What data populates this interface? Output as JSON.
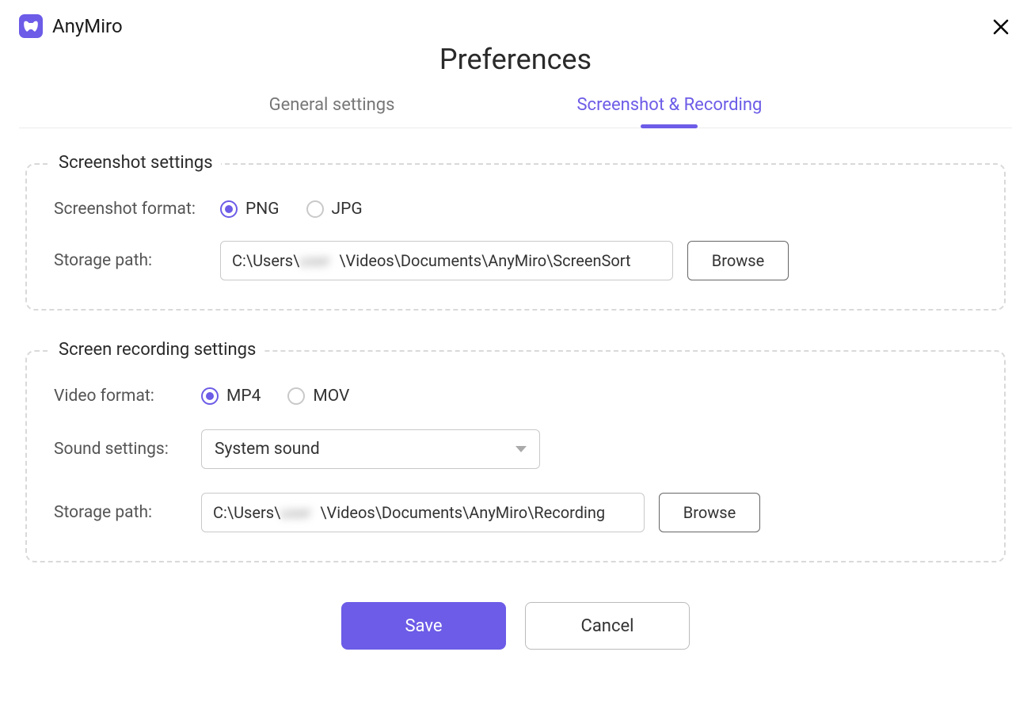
{
  "app": {
    "name": "AnyMiro"
  },
  "title": "Preferences",
  "tabs": {
    "general": "General settings",
    "recording": "Screenshot & Recording"
  },
  "screenshot": {
    "legend": "Screenshot settings",
    "format_label": "Screenshot format:",
    "options": {
      "png": "PNG",
      "jpg": "JPG"
    },
    "selected_format": "PNG",
    "path_label": "Storage path:",
    "path_prefix": "C:\\Users\\",
    "path_user_redacted": "user",
    "path_suffix": "\\Videos\\Documents\\AnyMiro\\ScreenSort",
    "browse": "Browse"
  },
  "recording": {
    "legend": "Screen recording settings",
    "format_label": "Video format:",
    "options": {
      "mp4": "MP4",
      "mov": "MOV"
    },
    "selected_format": "MP4",
    "sound_label": "Sound settings:",
    "sound_value": "System sound",
    "path_label": "Storage path:",
    "path_prefix": "C:\\Users\\",
    "path_user_redacted": "user",
    "path_suffix": "\\Videos\\Documents\\AnyMiro\\Recording",
    "browse": "Browse"
  },
  "footer": {
    "save": "Save",
    "cancel": "Cancel"
  }
}
